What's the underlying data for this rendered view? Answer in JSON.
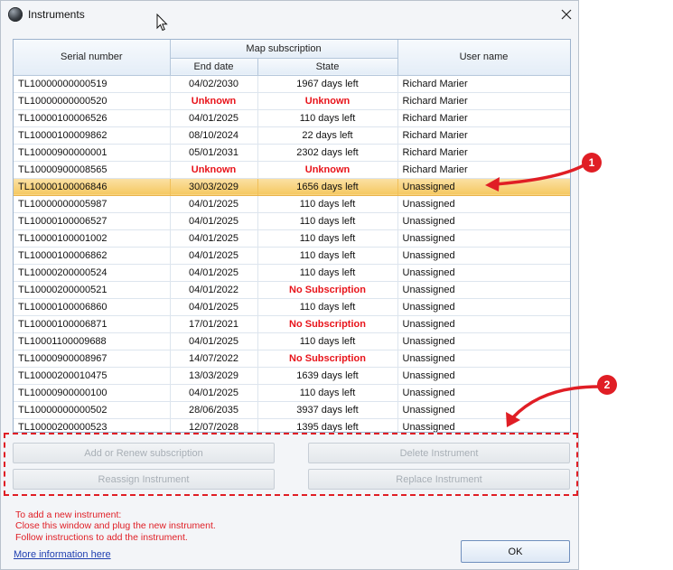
{
  "window": {
    "title": "Instruments"
  },
  "table": {
    "headers": {
      "serial": "Serial number",
      "map_subscription": "Map subscription",
      "end_date": "End date",
      "state": "State",
      "user": "User name"
    },
    "rows": [
      {
        "serial": "TL10000000000519",
        "end_date": "04/02/2030",
        "state": "1967 days left",
        "user": "Richard Marier"
      },
      {
        "serial": "TL10000000000520",
        "end_date": "Unknown",
        "state": "Unknown",
        "user": "Richard Marier"
      },
      {
        "serial": "TL10000100006526",
        "end_date": "04/01/2025",
        "state": "110 days left",
        "user": "Richard Marier"
      },
      {
        "serial": "TL10000100009862",
        "end_date": "08/10/2024",
        "state": "22 days left",
        "user": "Richard Marier"
      },
      {
        "serial": "TL10000900000001",
        "end_date": "05/01/2031",
        "state": "2302 days left",
        "user": "Richard Marier"
      },
      {
        "serial": "TL10000900008565",
        "end_date": "Unknown",
        "state": "Unknown",
        "user": "Richard Marier"
      },
      {
        "serial": "TL10000100006846",
        "end_date": "30/03/2029",
        "state": "1656 days left",
        "user": "Unassigned"
      },
      {
        "serial": "TL10000000005987",
        "end_date": "04/01/2025",
        "state": "110 days left",
        "user": "Unassigned"
      },
      {
        "serial": "TL10000100006527",
        "end_date": "04/01/2025",
        "state": "110 days left",
        "user": "Unassigned"
      },
      {
        "serial": "TL10000100001002",
        "end_date": "04/01/2025",
        "state": "110 days left",
        "user": "Unassigned"
      },
      {
        "serial": "TL10000100006862",
        "end_date": "04/01/2025",
        "state": "110 days left",
        "user": "Unassigned"
      },
      {
        "serial": "TL10000200000524",
        "end_date": "04/01/2025",
        "state": "110 days left",
        "user": "Unassigned"
      },
      {
        "serial": "TL10000200000521",
        "end_date": "04/01/2022",
        "state": "No Subscription",
        "user": "Unassigned"
      },
      {
        "serial": "TL10000100006860",
        "end_date": "04/01/2025",
        "state": "110 days left",
        "user": "Unassigned"
      },
      {
        "serial": "TL10000100006871",
        "end_date": "17/01/2021",
        "state": "No Subscription",
        "user": "Unassigned"
      },
      {
        "serial": "TL10001100009688",
        "end_date": "04/01/2025",
        "state": "110 days left",
        "user": "Unassigned"
      },
      {
        "serial": "TL10000900008967",
        "end_date": "14/07/2022",
        "state": "No Subscription",
        "user": "Unassigned"
      },
      {
        "serial": "TL10000200010475",
        "end_date": "13/03/2029",
        "state": "1639 days left",
        "user": "Unassigned"
      },
      {
        "serial": "TL10000900000100",
        "end_date": "04/01/2025",
        "state": "110 days left",
        "user": "Unassigned"
      },
      {
        "serial": "TL10000000000502",
        "end_date": "28/06/2035",
        "state": "3937 days left",
        "user": "Unassigned"
      },
      {
        "serial": "TL10000200000523",
        "end_date": "12/07/2028",
        "state": "1395 days left",
        "user": "Unassigned"
      }
    ],
    "selected_row": "TL10000100006846"
  },
  "buttons": {
    "add_renew": "Add or Renew subscription",
    "delete": "Delete Instrument",
    "reassign": "Reassign Instrument",
    "replace": "Replace Instrument",
    "ok": "OK"
  },
  "info": {
    "line1": "To add a new instrument:",
    "line2": "Close this window and plug the new instrument.",
    "line3": "Follow instructions to add the instrument.",
    "link": "More information here"
  },
  "annotations": {
    "callout1": "1",
    "callout2": "2",
    "color": "#e01e25"
  },
  "colors": {
    "warning_text": "#e8141b",
    "selected_row": "#f5c860",
    "header_border": "#9db3cd"
  }
}
